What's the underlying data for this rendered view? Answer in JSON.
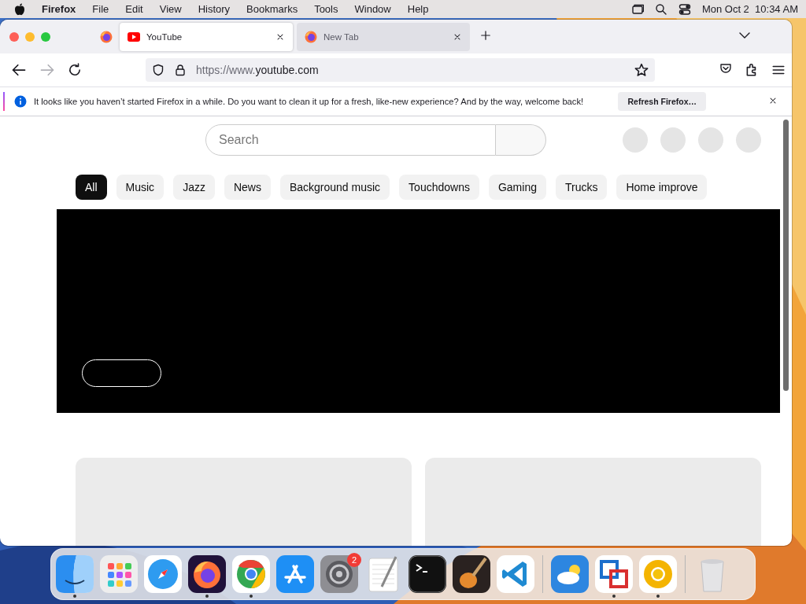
{
  "menubar": {
    "app": "Firefox",
    "menus": [
      "File",
      "Edit",
      "View",
      "History",
      "Bookmarks",
      "Tools",
      "Window",
      "Help"
    ],
    "clock": "Mon Oct 2  10:34 AM"
  },
  "tabs": [
    {
      "title": "YouTube",
      "selected": true,
      "kind": "youtube"
    },
    {
      "title": "New Tab",
      "selected": false,
      "kind": "firefox"
    }
  ],
  "address_bar": {
    "url_start": "https://www.",
    "url_domain": "youtube.com"
  },
  "notification": {
    "message": "It looks like you haven’t started Firefox in a while. Do you want to clean it up for a fresh, like-new experience? And by the way, welcome back!",
    "button": "Refresh Firefox…"
  },
  "page": {
    "search": {
      "placeholder": "Search"
    },
    "chips": [
      {
        "label": "All",
        "selected": true
      },
      {
        "label": "Music",
        "selected": false
      },
      {
        "label": "Jazz",
        "selected": false
      },
      {
        "label": "News",
        "selected": false
      },
      {
        "label": "Background music",
        "selected": false
      },
      {
        "label": "Touchdowns",
        "selected": false
      },
      {
        "label": "Gaming",
        "selected": false
      },
      {
        "label": "Trucks",
        "selected": false
      },
      {
        "label": "Home improve",
        "selected": false
      }
    ]
  },
  "dock": {
    "sections": [
      [
        {
          "kind": "finder",
          "running": true
        },
        {
          "kind": "launchpad",
          "running": false
        },
        {
          "kind": "safari",
          "running": false
        },
        {
          "kind": "firefox",
          "running": true
        },
        {
          "kind": "chrome",
          "running": true
        },
        {
          "kind": "appstore",
          "running": false
        },
        {
          "kind": "settings",
          "running": false,
          "badge": "2"
        },
        {
          "kind": "textedit",
          "running": false
        },
        {
          "kind": "terminal",
          "running": false
        },
        {
          "kind": "garageband",
          "running": false
        },
        {
          "kind": "vscode",
          "running": false
        }
      ],
      [
        {
          "kind": "weather",
          "running": false
        },
        {
          "kind": "vm",
          "running": true
        },
        {
          "kind": "canary",
          "running": true
        }
      ],
      [
        {
          "kind": "trash",
          "running": false
        }
      ]
    ]
  }
}
